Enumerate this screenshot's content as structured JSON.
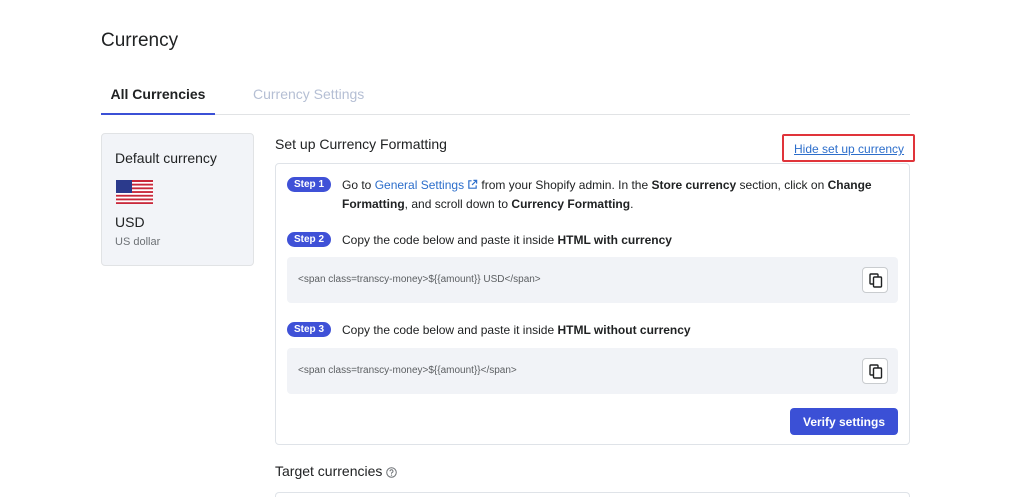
{
  "page": {
    "title": "Currency"
  },
  "tabs": [
    {
      "label": "All Currencies",
      "active": true
    },
    {
      "label": "Currency Settings",
      "active": false
    }
  ],
  "default_currency": {
    "label": "Default currency",
    "flag_icon": "us-flag-icon",
    "code": "USD",
    "name": "US dollar"
  },
  "setup": {
    "title": "Set up Currency Formatting",
    "hide_link": "Hide set up currency",
    "steps": [
      {
        "badge": "Step 1",
        "line1_pre": "Go to ",
        "link": "General Settings",
        "line1_mid": " from your Shopify admin. In the ",
        "bold1": "Store currency",
        "line1_post": " section, click on ",
        "bold2": "Change",
        "line2_bold": "Formatting",
        "line2_mid": ", and scroll down to ",
        "bold3": "Currency Formatting",
        "line2_post": "."
      },
      {
        "badge": "Step 2",
        "text": "Copy the code below and paste it inside ",
        "bold": "HTML with currency",
        "code": "<span class=transcy-money>${{amount}} USD</span>"
      },
      {
        "badge": "Step 3",
        "text": "Copy the code below and paste it inside ",
        "bold": "HTML without currency",
        "code": "<span class=transcy-money>${{amount}}</span>"
      }
    ],
    "verify_label": "Verify settings"
  },
  "target": {
    "title": "Target currencies"
  },
  "colors": {
    "accent": "#3b50d6",
    "link": "#2c6ecb",
    "highlight_box": "#e0343a"
  }
}
